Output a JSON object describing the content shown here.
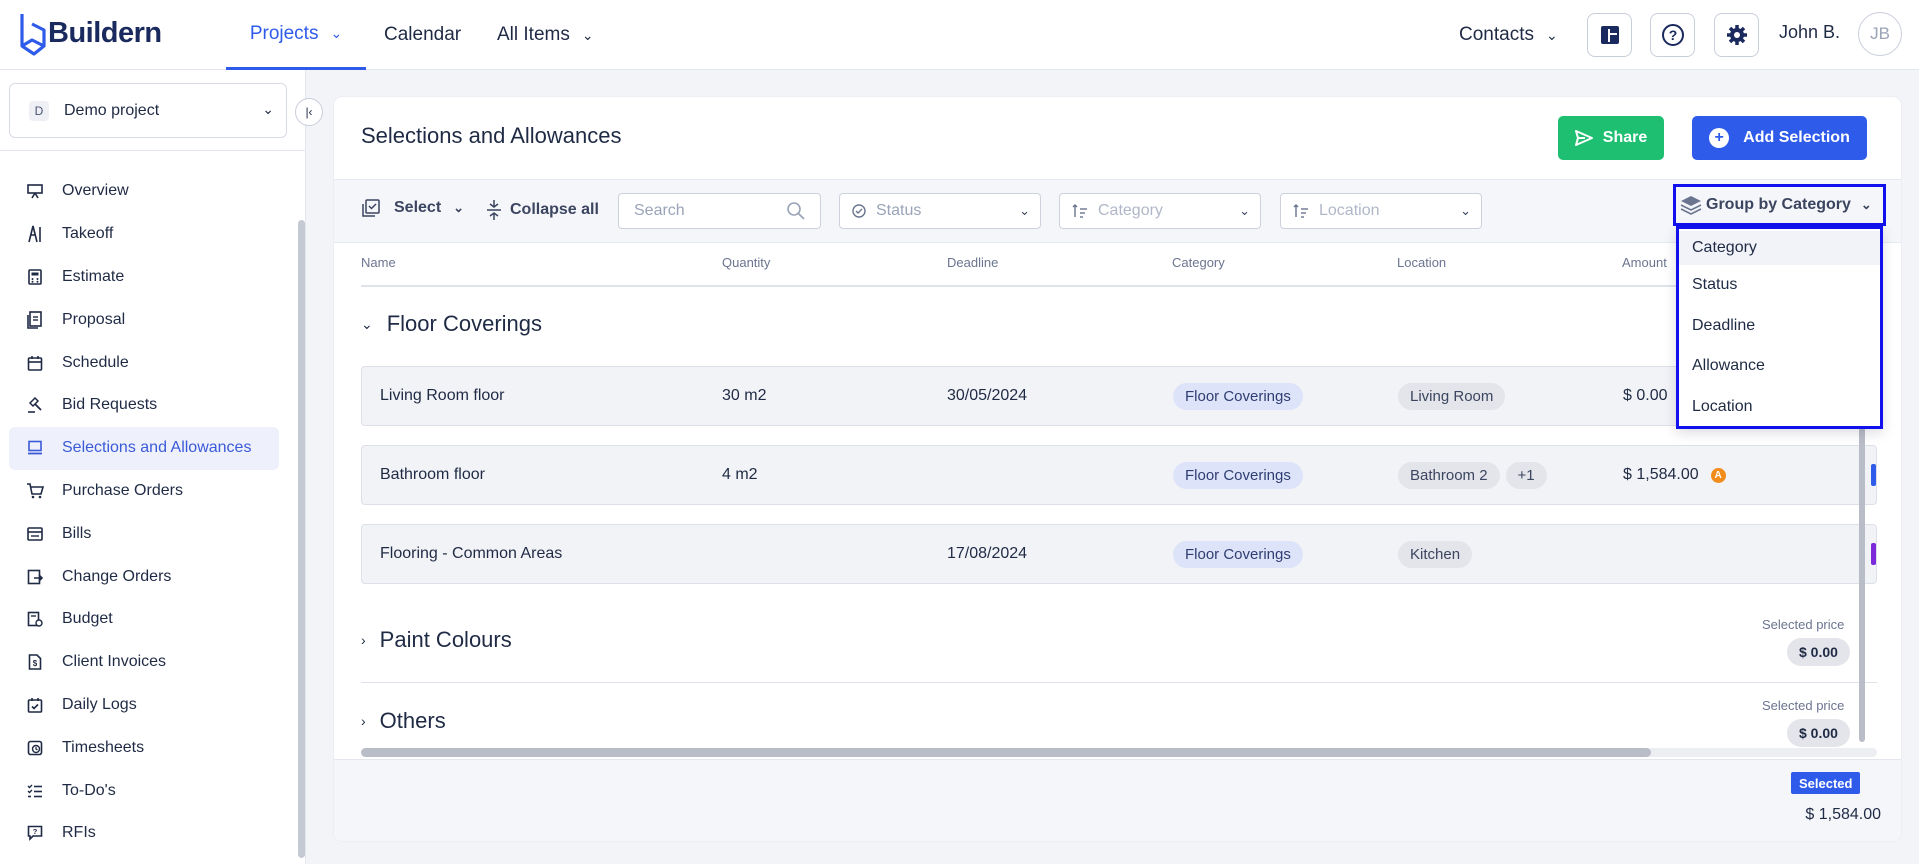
{
  "app": {
    "name": "Buildern"
  },
  "nav": {
    "projects": "Projects",
    "calendar": "Calendar",
    "all_items": "All Items",
    "contacts": "Contacts"
  },
  "user": {
    "name": "John B.",
    "initials": "JB"
  },
  "sidebar": {
    "project": {
      "badge": "D",
      "name": "Demo project"
    },
    "items": [
      {
        "label": "Overview",
        "icon": "presentation-icon"
      },
      {
        "label": "Takeoff",
        "icon": "takeoff-icon"
      },
      {
        "label": "Estimate",
        "icon": "calculator-icon"
      },
      {
        "label": "Proposal",
        "icon": "proposal-icon"
      },
      {
        "label": "Schedule",
        "icon": "calendar-icon"
      },
      {
        "label": "Bid Requests",
        "icon": "gavel-icon"
      },
      {
        "label": "Selections and Allowances",
        "icon": "monitor-icon",
        "active": true
      },
      {
        "label": "Purchase Orders",
        "icon": "cart-icon"
      },
      {
        "label": "Bills",
        "icon": "bills-icon"
      },
      {
        "label": "Change Orders",
        "icon": "change-order-icon"
      },
      {
        "label": "Budget",
        "icon": "budget-icon"
      },
      {
        "label": "Client Invoices",
        "icon": "invoice-icon"
      },
      {
        "label": "Daily Logs",
        "icon": "daily-log-icon"
      },
      {
        "label": "Timesheets",
        "icon": "timesheet-icon"
      },
      {
        "label": "To-Do's",
        "icon": "todo-icon"
      },
      {
        "label": "RFIs",
        "icon": "rfi-icon"
      }
    ]
  },
  "page": {
    "title": "Selections and Allowances",
    "share_label": "Share",
    "add_label": "Add Selection"
  },
  "toolbar": {
    "select_label": "Select",
    "collapse_label": "Collapse all",
    "search_placeholder": "Search",
    "status_placeholder": "Status",
    "category_placeholder": "Category",
    "location_placeholder": "Location",
    "group_by_label": "Group by Category"
  },
  "columns": [
    "Name",
    "Quantity",
    "Deadline",
    "Category",
    "Location",
    "Amount"
  ],
  "groups": [
    {
      "title": "Floor Coverings",
      "expanded": true,
      "rows": [
        {
          "name": "Living Room floor",
          "quantity": "30 m2",
          "deadline": "30/05/2024",
          "category": "Floor Coverings",
          "location": "Living Room",
          "location_extra": "",
          "amount": "$ 0.00"
        },
        {
          "name": "Bathroom floor",
          "quantity": "4 m2",
          "deadline": "",
          "category": "Floor Coverings",
          "location": "Bathroom 2",
          "location_extra": "+1",
          "amount": "$ 1,584.00",
          "warning": "A"
        },
        {
          "name": "Flooring - Common Areas",
          "quantity": "",
          "deadline": "17/08/2024",
          "category": "Floor Coverings",
          "location": "Kitchen",
          "location_extra": "",
          "amount": ""
        }
      ]
    },
    {
      "title": "Paint Colours",
      "expanded": false,
      "selected_label": "Selected price",
      "selected_value": "$ 0.00"
    },
    {
      "title": "Others",
      "expanded": false,
      "selected_label": "Selected price",
      "selected_value": "$ 0.00"
    }
  ],
  "footer": {
    "badge": "Selected",
    "amount": "$ 1,584.00"
  },
  "group_by_menu": [
    "Category",
    "Status",
    "Deadline",
    "Allowance",
    "Location"
  ],
  "colors": {
    "accent": "#2f5bea",
    "share": "#1fbf72",
    "warning": "#f28c1b",
    "highlight_outline": "#1111ee"
  }
}
